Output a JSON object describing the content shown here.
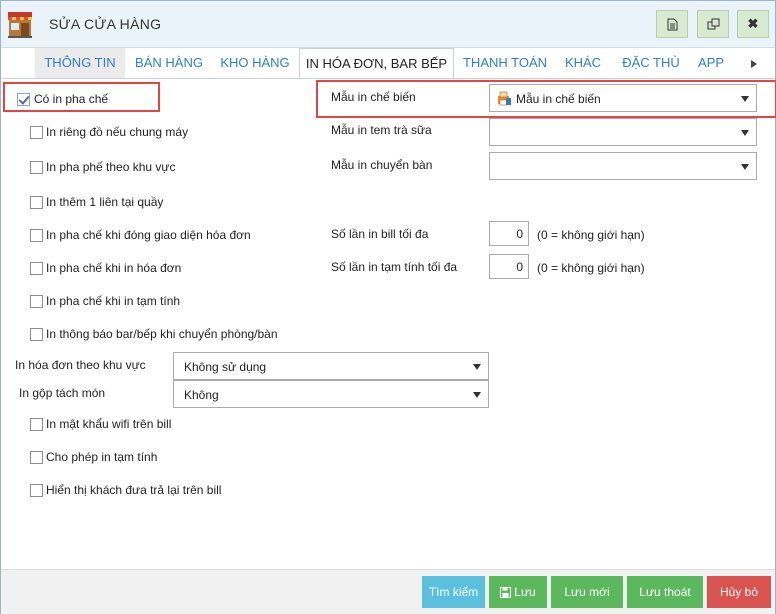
{
  "window": {
    "title": "SỬA CỬA HÀNG"
  },
  "title_buttons": {
    "close_label": "✖"
  },
  "tabs": [
    "THÔNG TIN",
    "BÁN HÀNG",
    "KHO HÀNG",
    "IN HÓA ĐƠN, BAR BẾP",
    "THANH TOÁN",
    "KHÁC",
    "ĐẶC THÙ",
    "APP"
  ],
  "left_options": {
    "co_in_pha_che": {
      "label": "Có in pha chế",
      "checked": true
    },
    "sub_options": [
      "In riêng đồ nếu chung máy",
      "In pha phế theo khu vực",
      "In thêm 1 liên tại quầy",
      "In pha chế khi đóng giao diện hóa đơn",
      "In pha chế khi in hóa đơn",
      "In pha chế khi in tạm tính",
      "In thông báo bar/bếp khi chuyển phòng/bàn"
    ],
    "in_hoa_don_theo_khu_vuc": {
      "label": "In hóa đơn theo khu vực",
      "value": "Không sử dụng"
    },
    "in_gop_tach_mon": {
      "label": "In gộp tách món",
      "value": "Không"
    },
    "bottom_options": [
      "In mật khẩu wifi trên bill",
      "Cho phép in tạm tính",
      "Hiển thị khách đưa trả lại trên bill"
    ]
  },
  "right_fields": {
    "mau_in_che_bien": {
      "label": "Mẫu in chế biến",
      "value": "Mẫu in chế biến"
    },
    "mau_in_tem_tra_sua": {
      "label": "Mẫu in tem trà sữa",
      "value": ""
    },
    "mau_in_chuyen_ban": {
      "label": "Mẫu in chuyển bàn",
      "value": ""
    },
    "so_lan_in_bill": {
      "label": "Số lần in bill tối đa",
      "value": "0",
      "hint": "(0 = không giới hạn)"
    },
    "so_lan_in_tam_tinh": {
      "label": "Số lần in tạm tính tối đa",
      "value": "0",
      "hint": "(0 = không giới hạn)"
    }
  },
  "footer": {
    "search": "Tìm kiếm",
    "save": "Lưu",
    "save_new": "Lưu mới",
    "save_exit": "Lưu thoát",
    "cancel": "Hủy bỏ"
  },
  "colors": {
    "tab_blue": "#2f7fc1",
    "highlight_red": "#e04646",
    "btn_teal": "#5bc0de",
    "btn_green": "#5cb85c",
    "btn_red": "#d9534f"
  }
}
